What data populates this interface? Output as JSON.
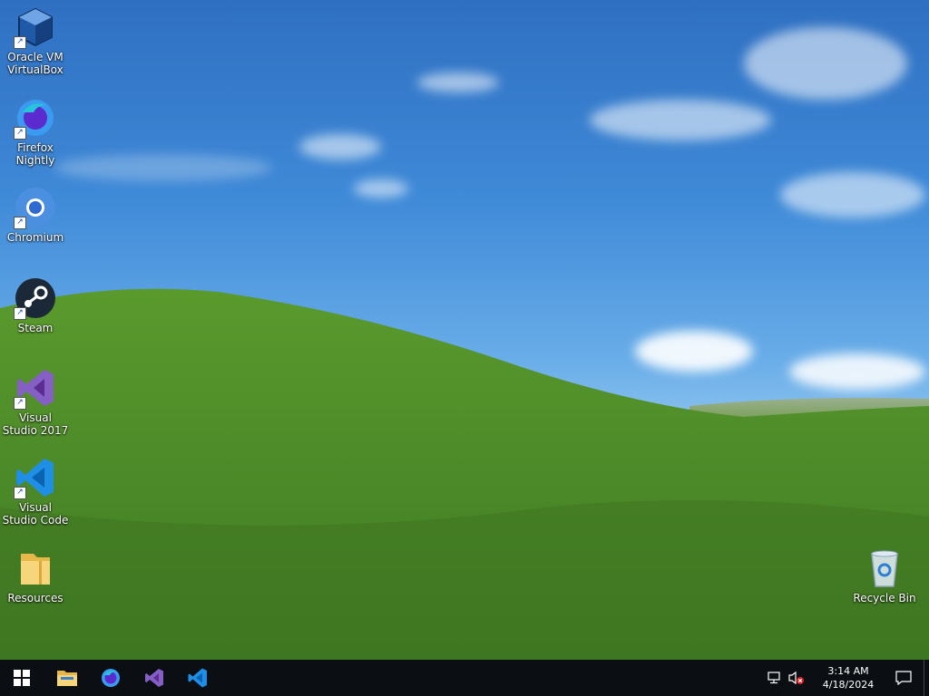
{
  "desktop": {
    "icons": [
      {
        "label": "Oracle VM VirtualBox",
        "icon": "virtualbox-icon"
      },
      {
        "label": "Firefox Nightly",
        "icon": "firefox-nightly-icon"
      },
      {
        "label": "Chromium",
        "icon": "chromium-icon"
      },
      {
        "label": "Steam",
        "icon": "steam-icon"
      },
      {
        "label": "Visual Studio 2017",
        "icon": "visual-studio-icon"
      },
      {
        "label": "Visual Studio Code",
        "icon": "vscode-icon"
      },
      {
        "label": "Resources",
        "icon": "folder-icon"
      }
    ],
    "recycle_bin": {
      "label": "Recycle Bin",
      "icon": "recycle-bin-icon"
    }
  },
  "taskbar": {
    "start": {
      "icon": "windows-start-icon"
    },
    "pinned": [
      {
        "icon": "file-explorer-icon"
      },
      {
        "icon": "firefox-nightly-icon"
      },
      {
        "icon": "visual-studio-icon"
      },
      {
        "icon": "vscode-icon"
      }
    ],
    "tray": {
      "network_icon": "network-icon",
      "volume_icon": "volume-muted-icon",
      "time": "3:14 AM",
      "date": "4/18/2024",
      "notification_icon": "action-center-icon"
    }
  },
  "colors": {
    "taskbar_bg": "#0b0f14",
    "sky_top": "#2f6fc1",
    "grass": "#4e8a2a"
  }
}
